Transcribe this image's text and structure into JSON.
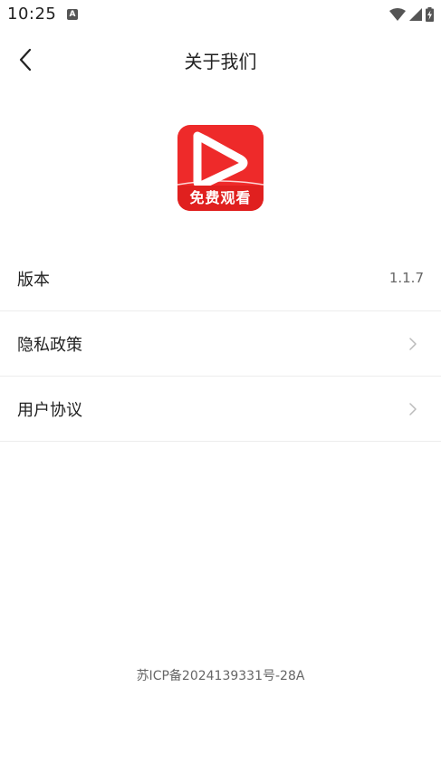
{
  "status_bar": {
    "time": "10:25",
    "notification_icon": "a-notification-icon",
    "wifi_icon": "wifi-icon",
    "signal_icon": "signal-icon",
    "battery_icon": "battery-charging-icon"
  },
  "app_bar": {
    "title": "关于我们",
    "back_icon": "chevron-left-icon"
  },
  "logo": {
    "text": "免费观看",
    "colors": {
      "background": "#ee2a2a",
      "band": "#e0201f",
      "play": "#ffffff"
    }
  },
  "settings": {
    "items": [
      {
        "label": "版本",
        "value": "1.1.7"
      },
      {
        "label": "隐私政策",
        "icon": "chevron-right-icon"
      },
      {
        "label": "用户协议",
        "icon": "chevron-right-icon"
      }
    ]
  },
  "footer": {
    "icp": "苏ICP备2024139331号-28A"
  }
}
